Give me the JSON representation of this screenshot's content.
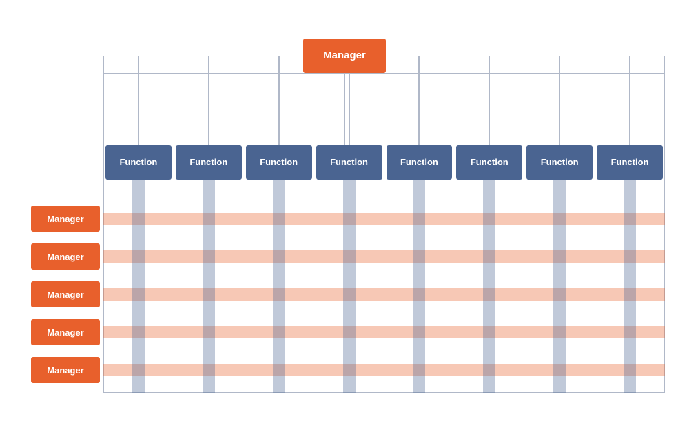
{
  "diagram": {
    "top_manager": {
      "label": "Manager"
    },
    "functions": [
      {
        "label": "Function"
      },
      {
        "label": "Function"
      },
      {
        "label": "Function"
      },
      {
        "label": "Function"
      },
      {
        "label": "Function"
      },
      {
        "label": "Function"
      },
      {
        "label": "Function"
      },
      {
        "label": "Function"
      }
    ],
    "managers": [
      {
        "label": "Manager"
      },
      {
        "label": "Manager"
      },
      {
        "label": "Manager"
      },
      {
        "label": "Manager"
      },
      {
        "label": "Manager"
      }
    ],
    "colors": {
      "manager_bg": "#e8602c",
      "function_bg": "#4a6491",
      "h_line": "rgba(232,96,44,0.35)",
      "v_line": "rgba(74,100,145,0.35)",
      "border": "#b0b8c8"
    }
  }
}
